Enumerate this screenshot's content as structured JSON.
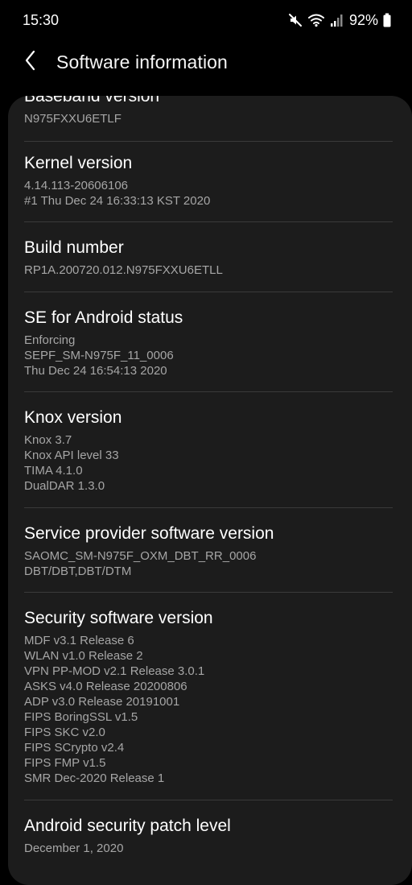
{
  "status_bar": {
    "time": "15:30",
    "battery": "92%",
    "icons": [
      "mute-icon",
      "wifi-icon",
      "signal-icon",
      "battery-icon"
    ]
  },
  "header": {
    "title": "Software information",
    "back_icon": "chevron-left-icon"
  },
  "sections": [
    {
      "title": "Baseband version",
      "values": [
        "N975FXXU6ETLF"
      ]
    },
    {
      "title": "Kernel version",
      "values": [
        "4.14.113-20606106",
        "#1 Thu Dec 24 16:33:13 KST 2020"
      ]
    },
    {
      "title": "Build number",
      "values": [
        "RP1A.200720.012.N975FXXU6ETLL"
      ]
    },
    {
      "title": "SE for Android status",
      "values": [
        "Enforcing",
        "SEPF_SM-N975F_11_0006",
        "Thu Dec 24 16:54:13 2020"
      ]
    },
    {
      "title": "Knox version",
      "values": [
        "Knox 3.7",
        "Knox API level 33",
        "TIMA 4.1.0",
        "DualDAR 1.3.0"
      ]
    },
    {
      "title": "Service provider software version",
      "values": [
        "SAOMC_SM-N975F_OXM_DBT_RR_0006",
        "DBT/DBT,DBT/DTM"
      ]
    },
    {
      "title": "Security software version",
      "values": [
        "MDF v3.1 Release 6",
        "WLAN v1.0 Release 2",
        "VPN PP-MOD v2.1 Release 3.0.1",
        "ASKS v4.0 Release 20200806",
        "ADP v3.0 Release 20191001",
        "FIPS BoringSSL v1.5",
        "FIPS SKC v2.0",
        "FIPS SCrypto v2.4",
        "FIPS FMP v1.5",
        "SMR Dec-2020 Release 1"
      ]
    },
    {
      "title": "Android security patch level",
      "values": [
        "December 1, 2020"
      ]
    }
  ],
  "colors": {
    "background": "#000000",
    "card": "#1c1c1c",
    "title_text": "#ffffff",
    "secondary_text": "#a6a6a6",
    "divider": "#3a3a3a"
  }
}
